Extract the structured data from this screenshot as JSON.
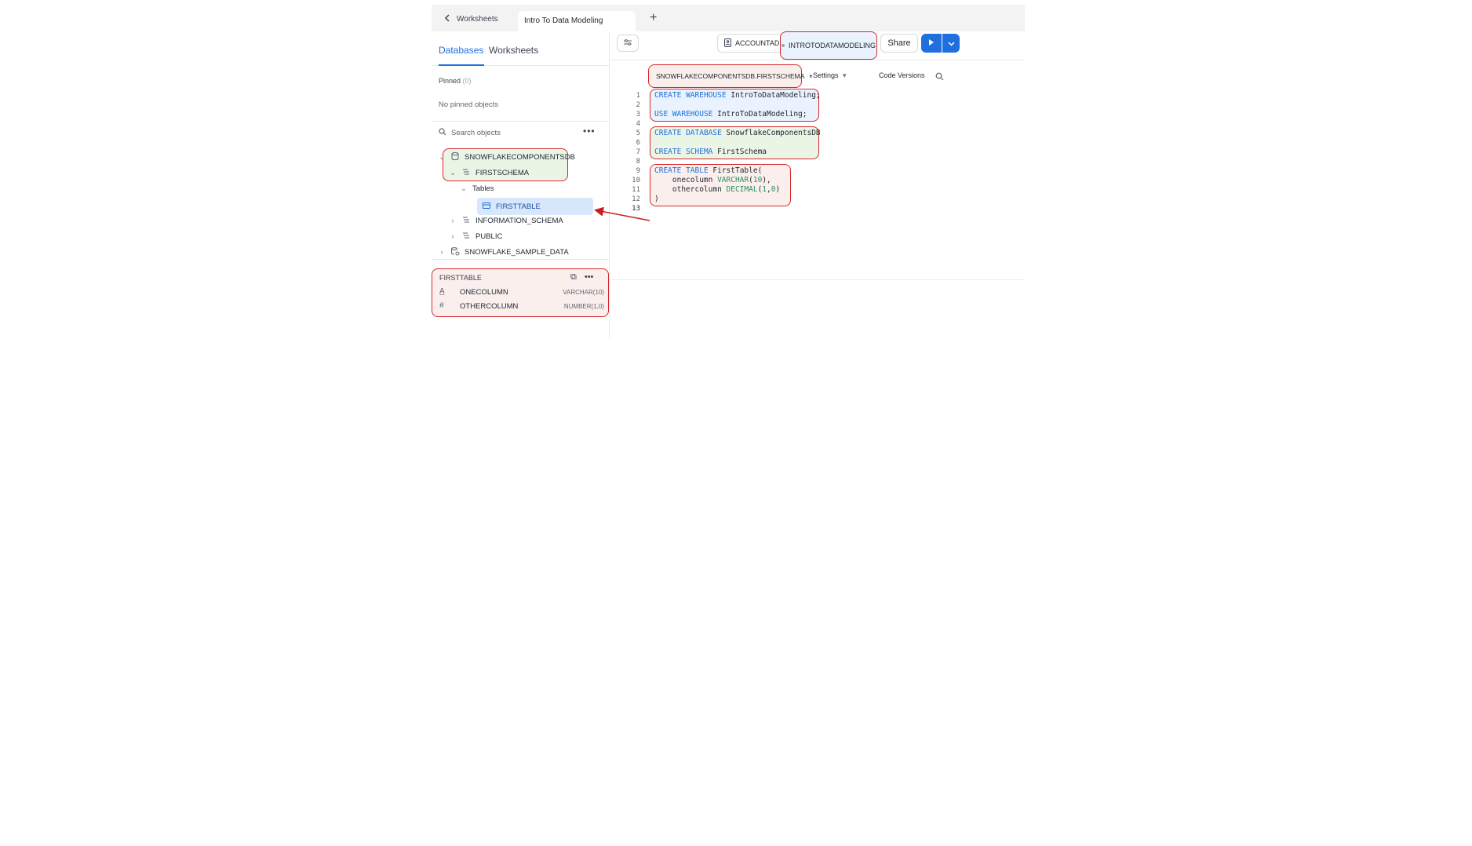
{
  "tabbar": {
    "back_label": "Worksheets",
    "active_tab": "Intro To Data Modeling",
    "add_tab": "+"
  },
  "sidebar": {
    "tabs": [
      "Databases",
      "Worksheets"
    ],
    "pinned_label": "Pinned",
    "pinned_count": "(0)",
    "no_pinned": "No pinned objects",
    "search_placeholder": "Search objects",
    "tree": {
      "db": "SNOWFLAKECOMPONENTSDB",
      "schema": "FIRSTSCHEMA",
      "tables_folder": "Tables",
      "table": "FIRSTTABLE",
      "info_schema": "INFORMATION_SCHEMA",
      "public": "PUBLIC",
      "sample_db": "SNOWFLAKE_SAMPLE_DATA"
    },
    "details": {
      "title": "FIRSTTABLE",
      "columns": [
        {
          "icon": "A̲",
          "name": "ONECOLUMN",
          "type": "VARCHAR(10)"
        },
        {
          "icon": "#",
          "name": "OTHERCOLUMN",
          "type": "NUMBER(1,0)"
        }
      ]
    }
  },
  "toolbar": {
    "role": "ACCOUNTADMIN",
    "warehouse": "INTROTODATAMODELING",
    "share": "Share"
  },
  "context": {
    "db_schema": "SNOWFLAKECOMPONENTSDB.FIRSTSCHEMA",
    "settings": "Settings",
    "code_versions": "Code Versions"
  },
  "editor": {
    "line_numbers": [
      "1",
      "2",
      "3",
      "4",
      "5",
      "6",
      "7",
      "8",
      "9",
      "10",
      "11",
      "12",
      "13"
    ],
    "lines": [
      "CREATE WAREHOUSE IntroToDataModeling;",
      "",
      "USE WAREHOUSE IntroToDataModeling;",
      "",
      "CREATE DATABASE SnowflakeComponentsDB",
      "",
      "CREATE SCHEMA FirstSchema",
      "",
      "CREATE TABLE FirstTable(",
      "    onecolumn VARCHAR(10),",
      "    othercolumn DECIMAL(1,0)",
      ")",
      ""
    ]
  },
  "colors": {
    "accent": "#1f6fde",
    "annotation": "#d62a2a",
    "green_fill": "#eaf5e6",
    "red_fill": "#fbefed",
    "blue_fill": "#e9f2fd"
  }
}
